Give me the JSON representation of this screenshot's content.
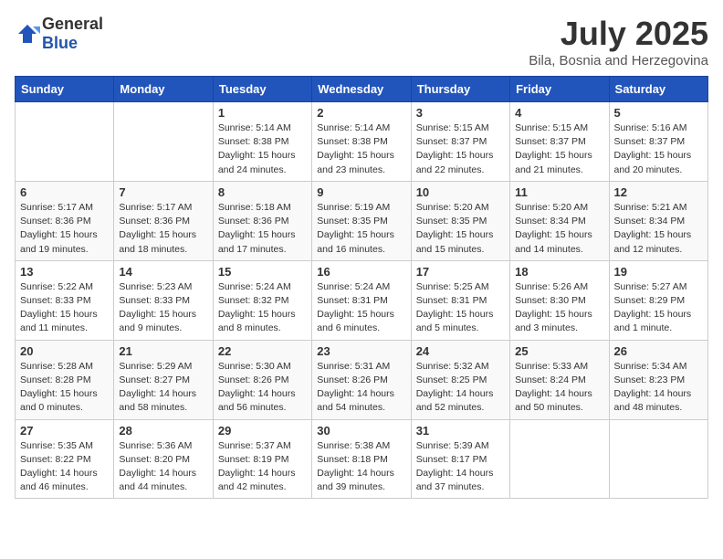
{
  "logo": {
    "general": "General",
    "blue": "Blue"
  },
  "title": "July 2025",
  "location": "Bila, Bosnia and Herzegovina",
  "weekdays": [
    "Sunday",
    "Monday",
    "Tuesday",
    "Wednesday",
    "Thursday",
    "Friday",
    "Saturday"
  ],
  "weeks": [
    [
      {
        "day": "",
        "info": ""
      },
      {
        "day": "",
        "info": ""
      },
      {
        "day": "1",
        "info": "Sunrise: 5:14 AM\nSunset: 8:38 PM\nDaylight: 15 hours and 24 minutes."
      },
      {
        "day": "2",
        "info": "Sunrise: 5:14 AM\nSunset: 8:38 PM\nDaylight: 15 hours and 23 minutes."
      },
      {
        "day": "3",
        "info": "Sunrise: 5:15 AM\nSunset: 8:37 PM\nDaylight: 15 hours and 22 minutes."
      },
      {
        "day": "4",
        "info": "Sunrise: 5:15 AM\nSunset: 8:37 PM\nDaylight: 15 hours and 21 minutes."
      },
      {
        "day": "5",
        "info": "Sunrise: 5:16 AM\nSunset: 8:37 PM\nDaylight: 15 hours and 20 minutes."
      }
    ],
    [
      {
        "day": "6",
        "info": "Sunrise: 5:17 AM\nSunset: 8:36 PM\nDaylight: 15 hours and 19 minutes."
      },
      {
        "day": "7",
        "info": "Sunrise: 5:17 AM\nSunset: 8:36 PM\nDaylight: 15 hours and 18 minutes."
      },
      {
        "day": "8",
        "info": "Sunrise: 5:18 AM\nSunset: 8:36 PM\nDaylight: 15 hours and 17 minutes."
      },
      {
        "day": "9",
        "info": "Sunrise: 5:19 AM\nSunset: 8:35 PM\nDaylight: 15 hours and 16 minutes."
      },
      {
        "day": "10",
        "info": "Sunrise: 5:20 AM\nSunset: 8:35 PM\nDaylight: 15 hours and 15 minutes."
      },
      {
        "day": "11",
        "info": "Sunrise: 5:20 AM\nSunset: 8:34 PM\nDaylight: 15 hours and 14 minutes."
      },
      {
        "day": "12",
        "info": "Sunrise: 5:21 AM\nSunset: 8:34 PM\nDaylight: 15 hours and 12 minutes."
      }
    ],
    [
      {
        "day": "13",
        "info": "Sunrise: 5:22 AM\nSunset: 8:33 PM\nDaylight: 15 hours and 11 minutes."
      },
      {
        "day": "14",
        "info": "Sunrise: 5:23 AM\nSunset: 8:33 PM\nDaylight: 15 hours and 9 minutes."
      },
      {
        "day": "15",
        "info": "Sunrise: 5:24 AM\nSunset: 8:32 PM\nDaylight: 15 hours and 8 minutes."
      },
      {
        "day": "16",
        "info": "Sunrise: 5:24 AM\nSunset: 8:31 PM\nDaylight: 15 hours and 6 minutes."
      },
      {
        "day": "17",
        "info": "Sunrise: 5:25 AM\nSunset: 8:31 PM\nDaylight: 15 hours and 5 minutes."
      },
      {
        "day": "18",
        "info": "Sunrise: 5:26 AM\nSunset: 8:30 PM\nDaylight: 15 hours and 3 minutes."
      },
      {
        "day": "19",
        "info": "Sunrise: 5:27 AM\nSunset: 8:29 PM\nDaylight: 15 hours and 1 minute."
      }
    ],
    [
      {
        "day": "20",
        "info": "Sunrise: 5:28 AM\nSunset: 8:28 PM\nDaylight: 15 hours and 0 minutes."
      },
      {
        "day": "21",
        "info": "Sunrise: 5:29 AM\nSunset: 8:27 PM\nDaylight: 14 hours and 58 minutes."
      },
      {
        "day": "22",
        "info": "Sunrise: 5:30 AM\nSunset: 8:26 PM\nDaylight: 14 hours and 56 minutes."
      },
      {
        "day": "23",
        "info": "Sunrise: 5:31 AM\nSunset: 8:26 PM\nDaylight: 14 hours and 54 minutes."
      },
      {
        "day": "24",
        "info": "Sunrise: 5:32 AM\nSunset: 8:25 PM\nDaylight: 14 hours and 52 minutes."
      },
      {
        "day": "25",
        "info": "Sunrise: 5:33 AM\nSunset: 8:24 PM\nDaylight: 14 hours and 50 minutes."
      },
      {
        "day": "26",
        "info": "Sunrise: 5:34 AM\nSunset: 8:23 PM\nDaylight: 14 hours and 48 minutes."
      }
    ],
    [
      {
        "day": "27",
        "info": "Sunrise: 5:35 AM\nSunset: 8:22 PM\nDaylight: 14 hours and 46 minutes."
      },
      {
        "day": "28",
        "info": "Sunrise: 5:36 AM\nSunset: 8:20 PM\nDaylight: 14 hours and 44 minutes."
      },
      {
        "day": "29",
        "info": "Sunrise: 5:37 AM\nSunset: 8:19 PM\nDaylight: 14 hours and 42 minutes."
      },
      {
        "day": "30",
        "info": "Sunrise: 5:38 AM\nSunset: 8:18 PM\nDaylight: 14 hours and 39 minutes."
      },
      {
        "day": "31",
        "info": "Sunrise: 5:39 AM\nSunset: 8:17 PM\nDaylight: 14 hours and 37 minutes."
      },
      {
        "day": "",
        "info": ""
      },
      {
        "day": "",
        "info": ""
      }
    ]
  ]
}
